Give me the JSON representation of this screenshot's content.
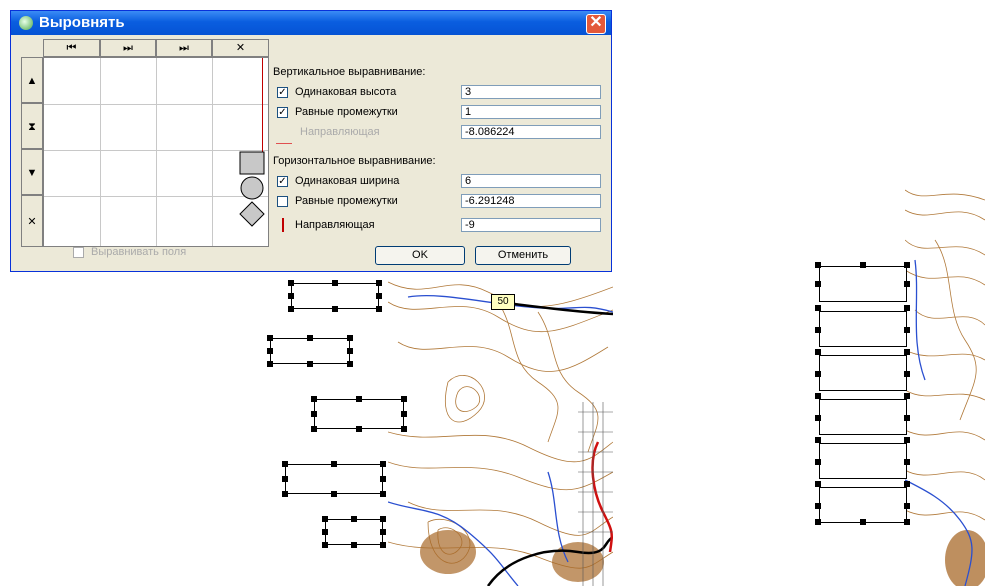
{
  "dialog": {
    "title": "Выровнять",
    "close_glyph": "✕",
    "col_buttons": [
      "⏮",
      "⏭",
      "⏭",
      "✕"
    ],
    "row_buttons": [
      "▲",
      "⧗",
      "▼",
      "✕"
    ],
    "vertical_header": "Вертикальное выравнивание:",
    "same_height_label": "Одинаковая высота",
    "same_height_checked": "✓",
    "same_height_value": "3",
    "equal_gaps_v_label": "Равные промежутки",
    "equal_gaps_v_checked": "✓",
    "equal_gaps_v_value": "1",
    "guide_v_label": "Направляющая",
    "guide_v_value": "-8.086224",
    "horizontal_header": "Горизонтальное выравнивание:",
    "same_width_label": "Одинаковая ширина",
    "same_width_checked": "✓",
    "same_width_value": "6",
    "equal_gaps_h_label": "Равные промежутки",
    "equal_gaps_h_value": "-6.291248",
    "guide_h_label": "Направляющая",
    "guide_h_value": "-9",
    "align_fields_label": "Выравнивать поля",
    "ok_label": "OK",
    "cancel_label": "Отменить"
  },
  "map": {
    "label_value": "50",
    "contour_color": "#b07838",
    "water_color": "#2a4fd0",
    "road_color": "#000000",
    "highlight_road_color": "#d01010"
  }
}
